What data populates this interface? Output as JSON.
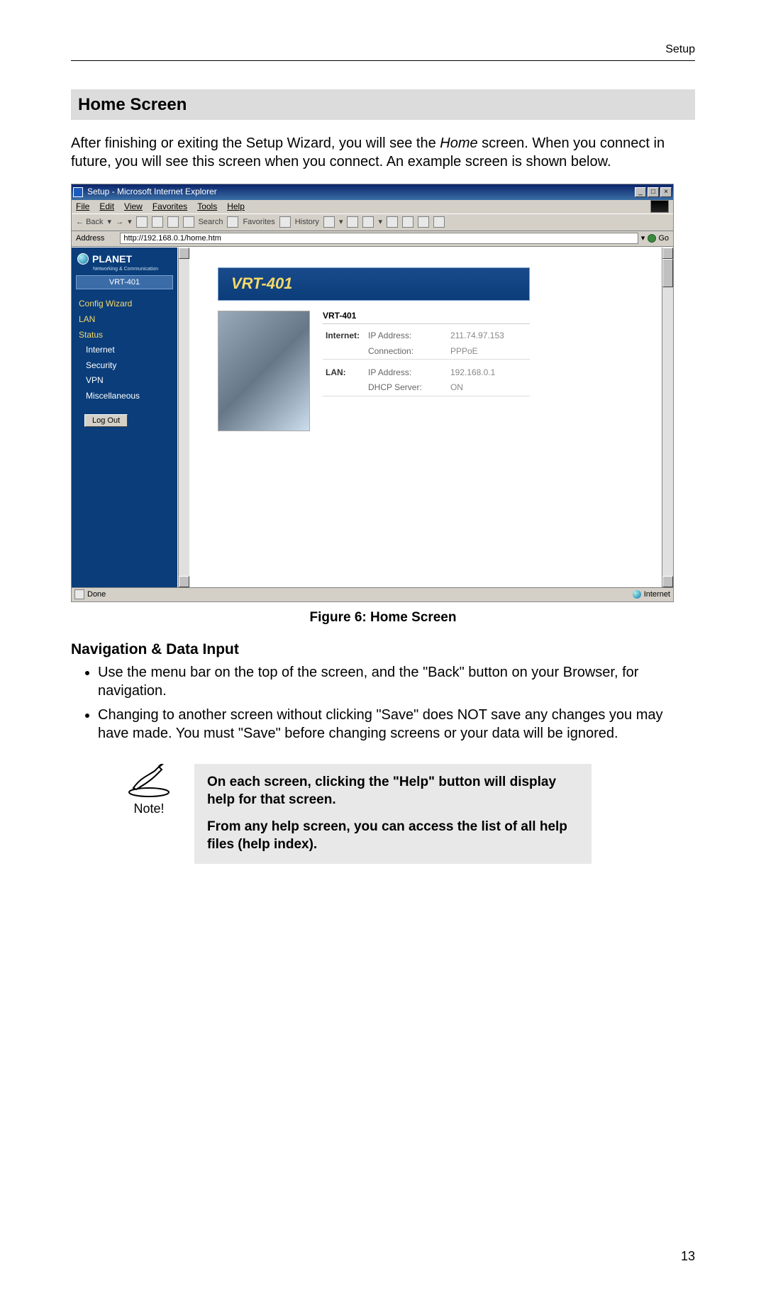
{
  "runningHead": "Setup",
  "sectionTitle": "Home Screen",
  "introBefore": "After finishing or exiting the Setup Wizard, you will see the ",
  "introEm": "Home",
  "introAfter": " screen. When you connect in future, you will see this screen when you connect. An example screen is shown below.",
  "figureCaption": "Figure 6: Home Screen",
  "subhead": "Navigation & Data Input",
  "bullets": [
    "Use the menu bar on the top of the screen, and the \"Back\" button on your Browser, for navigation.",
    "Changing to another screen without clicking \"Save\" does NOT save any changes you may have made. You must \"Save\" before changing screens or your data will be ignored."
  ],
  "noteLabel": "Note!",
  "noteParas": [
    "On each screen, clicking the \"Help\" button will display help for that screen.",
    "From any help screen, you can access the list of all help files (help index)."
  ],
  "pageNumber": "13",
  "ie": {
    "title": "Setup - Microsoft Internet Explorer",
    "menus": [
      "File",
      "Edit",
      "View",
      "Favorites",
      "Tools",
      "Help"
    ],
    "toolbarBack": "Back",
    "toolbarSearch": "Search",
    "toolbarFavorites": "Favorites",
    "toolbarHistory": "History",
    "addressLabel": "Address",
    "addressValue": "http://192.168.0.1/home.htm",
    "goLabel": "Go",
    "statusDone": "Done",
    "statusZone": "Internet"
  },
  "router": {
    "brand": "PLANET",
    "brandSub": "Networking & Communication",
    "model": "VRT-401",
    "nav": {
      "configWizard": "Config Wizard",
      "lan": "LAN",
      "status": "Status",
      "internet": "Internet",
      "security": "Security",
      "vpn": "VPN",
      "misc": "Miscellaneous"
    },
    "logout": "Log Out",
    "heroTitle": "VRT-401",
    "infoTitle": "VRT-401",
    "rows": {
      "internetLabel": "Internet:",
      "ipAddrLabel": "IP Address:",
      "ipAddrVal": "211.74.97.153",
      "connLabel": "Connection:",
      "connVal": "PPPoE",
      "lanLabel": "LAN:",
      "lanIpLabel": "IP Address:",
      "lanIpVal": "192.168.0.1",
      "dhcpLabel": "DHCP Server:",
      "dhcpVal": "ON"
    }
  }
}
